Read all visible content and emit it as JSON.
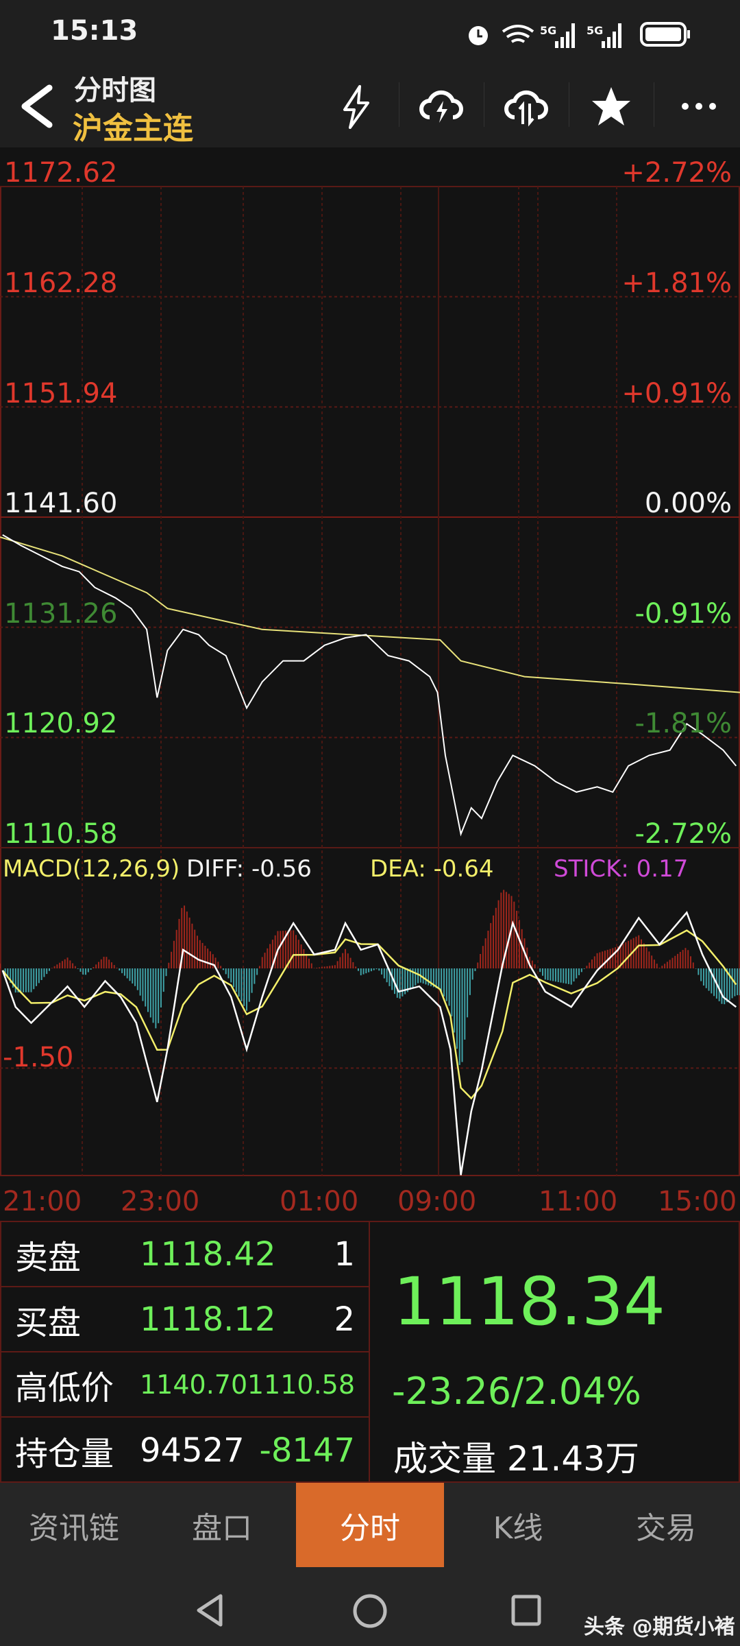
{
  "status_bar": {
    "time": "15:13",
    "network": "5G",
    "network2": "5G"
  },
  "header": {
    "title": "分时图",
    "subtitle": "沪金主连",
    "icons": [
      "flash-icon",
      "cloud-flash-icon",
      "cloud-sync-icon",
      "star-icon",
      "more-icon"
    ]
  },
  "price_axis": {
    "left": [
      "1172.62",
      "1162.28",
      "1151.94",
      "1141.60",
      "1131.26",
      "1120.92",
      "1110.58"
    ],
    "right": [
      "+2.72%",
      "+1.81%",
      "+0.91%",
      "0.00%",
      "-0.91%",
      "-1.81%",
      "-2.72%"
    ]
  },
  "macd": {
    "title": "MACD(12,26,9)",
    "diff": "DIFF: -0.56",
    "dea": "DEA: -0.64",
    "stick": "STICK: 0.17",
    "axis_label": "-1.50"
  },
  "time_axis": [
    "21:00",
    "23:00",
    "01:00",
    "09:00",
    "11:00",
    "15:00"
  ],
  "colors": {
    "up": "#e0382c",
    "down": "#6ef05a",
    "accent": "#d96a2a",
    "avg_line": "#e8e27a",
    "hist_up": "#a0261c",
    "hist_down": "#3fa3a8"
  },
  "chart_data": {
    "type": "line",
    "price": {
      "ylim": [
        1110.58,
        1172.62
      ],
      "xlim": [
        0,
        570
      ],
      "x": [
        2,
        16,
        32,
        48,
        61,
        73,
        89,
        101,
        113,
        121,
        129,
        141,
        153,
        161,
        174,
        190,
        202,
        218,
        234,
        250,
        266,
        282,
        299,
        315,
        331,
        337,
        343,
        355,
        363,
        371,
        383,
        395,
        412,
        428,
        444,
        460,
        472,
        484,
        500,
        516,
        529,
        541,
        557,
        567
      ],
      "y": [
        1139.93,
        1138.94,
        1137.96,
        1136.97,
        1136.48,
        1135.0,
        1134.02,
        1133.03,
        1131.06,
        1124.66,
        1129.09,
        1131.06,
        1130.57,
        1129.58,
        1128.6,
        1123.68,
        1126.14,
        1128.11,
        1128.11,
        1129.58,
        1130.27,
        1130.57,
        1128.6,
        1128.11,
        1126.63,
        1125.15,
        1119.24,
        1111.86,
        1114.32,
        1113.33,
        1116.78,
        1119.24,
        1118.26,
        1116.78,
        1115.8,
        1116.29,
        1115.8,
        1118.26,
        1119.24,
        1119.74,
        1122.2,
        1121.21,
        1119.74,
        1118.26
      ],
      "avg_x": [
        0,
        48,
        113,
        129,
        202,
        339,
        355,
        404,
        484,
        570
      ],
      "avg_y": [
        1139.73,
        1137.96,
        1134.51,
        1133.03,
        1131.06,
        1130.08,
        1128.11,
        1126.63,
        1125.94,
        1125.15
      ]
    },
    "macd": {
      "zero": 0,
      "gridline": -1.5,
      "x": [
        2,
        12,
        24,
        40,
        52,
        65,
        81,
        93,
        105,
        121,
        129,
        141,
        153,
        165,
        178,
        190,
        202,
        214,
        226,
        242,
        258,
        266,
        278,
        291,
        307,
        323,
        339,
        347,
        355,
        363,
        371,
        387,
        395,
        408,
        420,
        440,
        460,
        476,
        492,
        508,
        529,
        541,
        557,
        567
      ],
      "diff": [
        -0.03,
        -0.58,
        -0.82,
        -0.51,
        -0.27,
        -0.58,
        -0.19,
        -0.43,
        -0.82,
        -2.01,
        -1.22,
        0.28,
        0.13,
        0.05,
        -0.43,
        -1.22,
        -0.43,
        0.28,
        0.68,
        0.21,
        0.28,
        0.68,
        0.28,
        0.36,
        -0.35,
        -0.27,
        -0.58,
        -1.22,
        -3.11,
        -2.15,
        -1.53,
        0.05,
        0.68,
        0.05,
        -0.35,
        -0.58,
        -0.03,
        0.28,
        0.76,
        0.36,
        0.84,
        0.21,
        -0.43,
        -0.58
      ]
    }
  },
  "quote": {
    "sell_label": "卖盘",
    "sell_price": "1118.42",
    "sell_qty": "1",
    "buy_label": "买盘",
    "buy_price": "1118.12",
    "buy_qty": "2",
    "hl_label": "高低价",
    "high": "1140.70",
    "low": "1110.58",
    "oi_label": "持仓量",
    "oi": "94527",
    "oi_change": "-8147",
    "last": "1118.34",
    "change": "-23.26/2.04%",
    "vol_label": "成交量",
    "vol": "21.43万"
  },
  "tabs": [
    {
      "label": "资讯链"
    },
    {
      "label": "盘口"
    },
    {
      "label": "分时",
      "active": true
    },
    {
      "label": "K线"
    },
    {
      "label": "交易"
    }
  ],
  "watermark": "头条 @期货小褚"
}
